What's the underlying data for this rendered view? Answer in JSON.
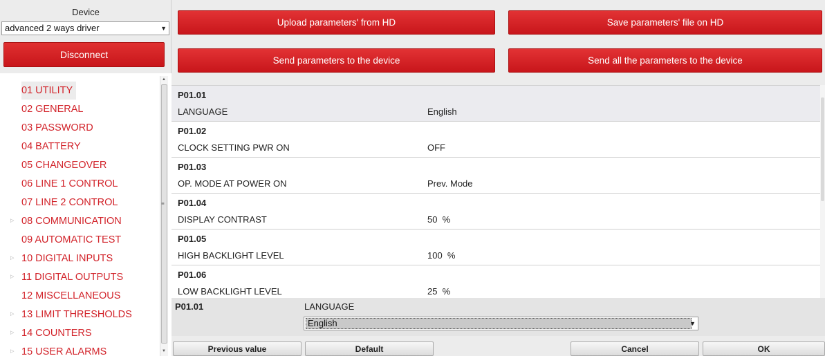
{
  "device": {
    "label": "Device",
    "selected": "advanced 2 ways driver"
  },
  "disconnect_label": "Disconnect",
  "menu": {
    "items": [
      {
        "label": "01 UTILITY",
        "expandable": false,
        "selected": true
      },
      {
        "label": "02 GENERAL",
        "expandable": false
      },
      {
        "label": "03 PASSWORD",
        "expandable": false
      },
      {
        "label": "04 BATTERY",
        "expandable": false
      },
      {
        "label": "05 CHANGEOVER",
        "expandable": false
      },
      {
        "label": "06 LINE 1 CONTROL",
        "expandable": false
      },
      {
        "label": "07 LINE 2 CONTROL",
        "expandable": false
      },
      {
        "label": "08 COMMUNICATION",
        "expandable": true
      },
      {
        "label": "09 AUTOMATIC TEST",
        "expandable": false
      },
      {
        "label": "10 DIGITAL INPUTS",
        "expandable": true
      },
      {
        "label": "11 DIGITAL OUTPUTS",
        "expandable": true
      },
      {
        "label": "12 MISCELLANEOUS",
        "expandable": false
      },
      {
        "label": "13 LIMIT THRESHOLDS",
        "expandable": true
      },
      {
        "label": "14 COUNTERS",
        "expandable": true
      },
      {
        "label": "15 USER ALARMS",
        "expandable": true
      }
    ]
  },
  "toolbar": {
    "upload_label": "Upload parameters' from HD",
    "save_label": "Save parameters' file on HD",
    "send_label": "Send parameters to the device",
    "send_all_label": "Send all the parameters to the device"
  },
  "params": [
    {
      "code": "P01.01",
      "name": "LANGUAGE",
      "value": "English",
      "selected": true
    },
    {
      "code": "P01.02",
      "name": "CLOCK SETTING PWR ON",
      "value": "OFF"
    },
    {
      "code": "P01.03",
      "name": "OP. MODE AT POWER ON",
      "value": "Prev. Mode"
    },
    {
      "code": "P01.04",
      "name": "DISPLAY CONTRAST",
      "value": "50  %"
    },
    {
      "code": "P01.05",
      "name": "HIGH BACKLIGHT LEVEL",
      "value": "100  %"
    },
    {
      "code": "P01.06",
      "name": "LOW BACKLIGHT LEVEL",
      "value": "25  %"
    }
  ],
  "editor": {
    "code": "P01.01",
    "name": "LANGUAGE",
    "value": "English"
  },
  "footer": {
    "previous_label": "Previous value",
    "default_label": "Default",
    "cancel_label": "Cancel",
    "ok_label": "OK"
  },
  "colors": {
    "accent_red": "#d2232a",
    "button_red": "#c8161b"
  }
}
